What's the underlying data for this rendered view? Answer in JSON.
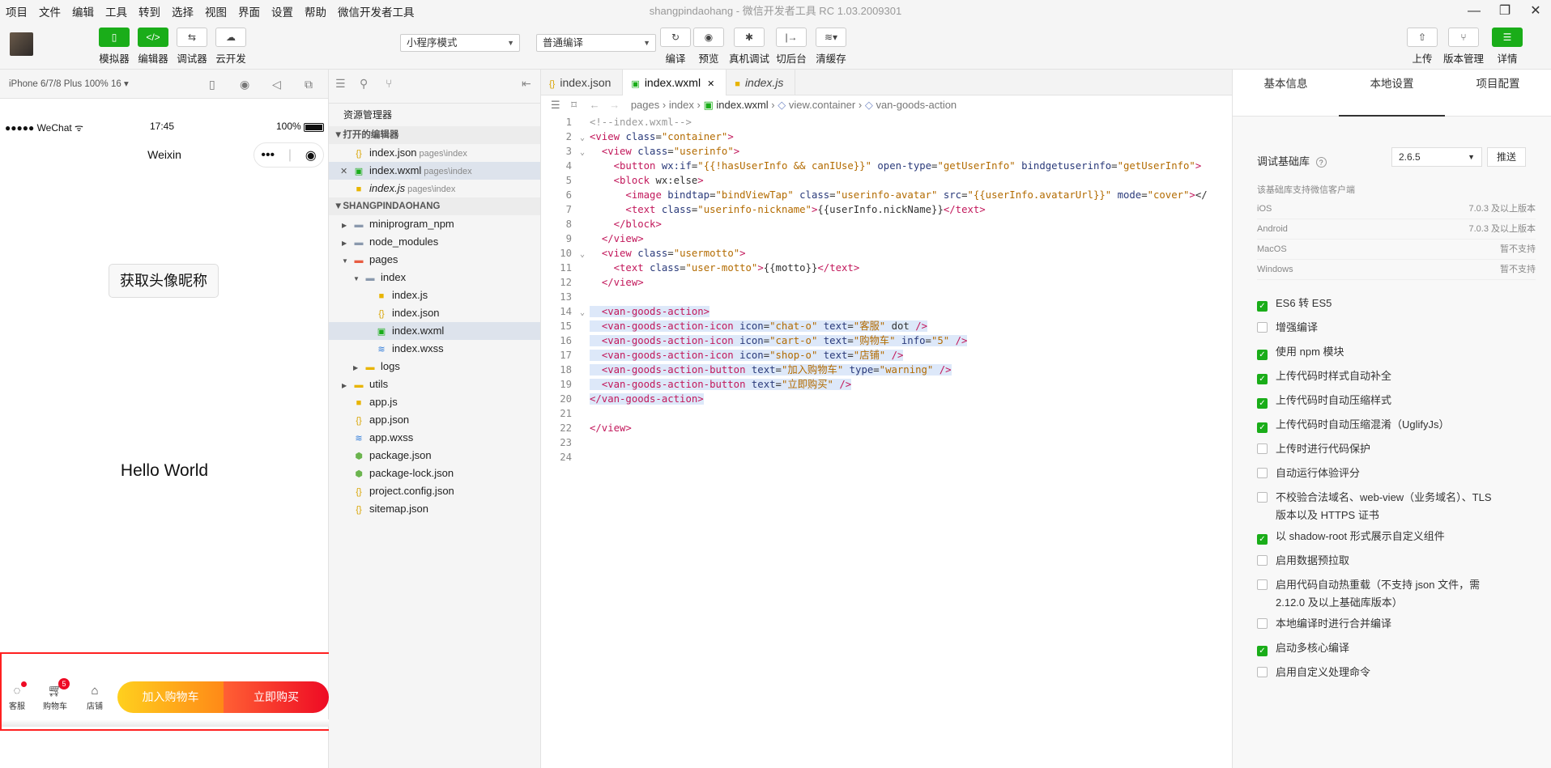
{
  "menu": [
    "项目",
    "文件",
    "编辑",
    "工具",
    "转到",
    "选择",
    "视图",
    "界面",
    "设置",
    "帮助",
    "微信开发者工具"
  ],
  "window_title": "shangpindaohang - 微信开发者工具 RC 1.03.2009301",
  "window_controls": {
    "minimize": "—",
    "maximize": "❐",
    "close": "✕"
  },
  "toolbar": {
    "left": [
      "模拟器",
      "编辑器",
      "调试器",
      "云开发"
    ],
    "mode_select": "小程序模式",
    "compile_select": "普通编译",
    "center": [
      "编译",
      "预览",
      "真机调试",
      "切后台",
      "清缓存"
    ],
    "right": [
      "上传",
      "版本管理",
      "详情"
    ]
  },
  "simulator": {
    "device": "iPhone 6/7/8 Plus 100% 16",
    "carrier": "●●●●● WeChat",
    "time": "17:45",
    "battery": "100%",
    "nav_title": "Weixin",
    "get_button": "获取头像昵称",
    "motto": "Hello World",
    "actions": [
      {
        "icon": "chat-o",
        "label": "客服"
      },
      {
        "icon": "cart-o",
        "label": "购物车",
        "info": "5"
      },
      {
        "icon": "shop-o",
        "label": "店铺"
      }
    ],
    "add_cart": "加入购物车",
    "buy_now": "立即购买",
    "accent_red": "#ee0a24",
    "accent_orange": "#ff8917"
  },
  "explorer": {
    "title": "资源管理器",
    "open_editors_title": "打开的编辑器",
    "open_editors": [
      {
        "name": "index.json",
        "path": "pages\\index",
        "type": "json"
      },
      {
        "name": "index.wxml",
        "path": "pages\\index",
        "type": "wxml",
        "close": "✕"
      },
      {
        "name": "index.js",
        "path": "pages\\index",
        "type": "js"
      }
    ],
    "project_title": "SHANGPINDAOHANG",
    "tree": [
      {
        "name": "miniprogram_npm",
        "type": "folder"
      },
      {
        "name": "node_modules",
        "type": "folder"
      },
      {
        "name": "pages",
        "type": "folder-open"
      },
      {
        "name": "index",
        "type": "folder-open"
      },
      {
        "name": "index.js",
        "type": "js"
      },
      {
        "name": "index.json",
        "type": "json"
      },
      {
        "name": "index.wxml",
        "type": "wxml"
      },
      {
        "name": "index.wxss",
        "type": "wxss"
      },
      {
        "name": "logs",
        "type": "folder"
      },
      {
        "name": "utils",
        "type": "folder"
      },
      {
        "name": "app.js",
        "type": "js"
      },
      {
        "name": "app.json",
        "type": "json"
      },
      {
        "name": "app.wxss",
        "type": "wxss"
      },
      {
        "name": "package.json",
        "type": "pkg"
      },
      {
        "name": "package-lock.json",
        "type": "pkg"
      },
      {
        "name": "project.config.json",
        "type": "json"
      },
      {
        "name": "sitemap.json",
        "type": "json"
      }
    ]
  },
  "editor": {
    "tabs": [
      "index.json",
      "index.wxml",
      "index.js"
    ],
    "breadcrumb": [
      "pages",
      "index",
      "index.wxml",
      "view.container",
      "van-goods-action"
    ],
    "lines": [
      "<!--index.wxml-->",
      "<view class=\"container\">",
      "  <view class=\"userinfo\">",
      "    <button wx:if=\"{{!hasUserInfo && canIUse}}\" open-type=\"getUserInfo\" bindgetuserinfo=\"getUserInfo\">",
      "    <block wx:else>",
      "      <image bindtap=\"bindViewTap\" class=\"userinfo-avatar\" src=\"{{userInfo.avatarUrl}}\" mode=\"cover\"></",
      "      <text class=\"userinfo-nickname\">{{userInfo.nickName}}</text>",
      "    </block>",
      "  </view>",
      "  <view class=\"usermotto\">",
      "    <text class=\"user-motto\">{{motto}}</text>",
      "  </view>",
      "",
      "  <van-goods-action>",
      "  <van-goods-action-icon icon=\"chat-o\" text=\"客服\" dot />",
      "  <van-goods-action-icon icon=\"cart-o\" text=\"购物车\" info=\"5\" />",
      "  <van-goods-action-icon icon=\"shop-o\" text=\"店铺\" />",
      "  <van-goods-action-button text=\"加入购物车\" type=\"warning\" />",
      "  <van-goods-action-button text=\"立即购买\" />",
      "</van-goods-action>",
      "",
      "</view>",
      "",
      ""
    ]
  },
  "settings": {
    "tabs": [
      "基本信息",
      "本地设置",
      "项目配置"
    ],
    "base_lib_label": "调试基础库",
    "base_lib_value": "2.6.5",
    "push_button": "推送",
    "support_title": "该基础库支持微信客户端",
    "support": [
      {
        "os": "iOS",
        "value": "7.0.3 及以上版本"
      },
      {
        "os": "Android",
        "value": "7.0.3 及以上版本"
      },
      {
        "os": "MacOS",
        "value": "暂不支持"
      },
      {
        "os": "Windows",
        "value": "暂不支持"
      }
    ],
    "options": [
      {
        "label": "ES6 转 ES5",
        "checked": true
      },
      {
        "label": "增强编译",
        "checked": false
      },
      {
        "label": "使用 npm 模块",
        "checked": true
      },
      {
        "label": "上传代码时样式自动补全",
        "checked": true
      },
      {
        "label": "上传代码时自动压缩样式",
        "checked": true
      },
      {
        "label": "上传代码时自动压缩混淆（UglifyJs）",
        "checked": true
      },
      {
        "label": "上传时进行代码保护",
        "checked": false
      },
      {
        "label": "自动运行体验评分",
        "checked": false
      },
      {
        "label": "不校验合法域名、web-view（业务域名）、TLS",
        "label2": "版本以及 HTTPS 证书",
        "checked": false
      },
      {
        "label": "以 shadow-root 形式展示自定义组件",
        "checked": true
      },
      {
        "label": "启用数据预拉取",
        "checked": false
      },
      {
        "label": "启用代码自动热重载（不支持 json 文件，需",
        "label2": "2.12.0 及以上基础库版本）",
        "checked": false
      },
      {
        "label": "本地编译时进行合并编译",
        "checked": false
      },
      {
        "label": "启动多核心编译",
        "checked": true
      },
      {
        "label": "启用自定义处理命令",
        "checked": false
      }
    ],
    "green": "#1aad19"
  }
}
